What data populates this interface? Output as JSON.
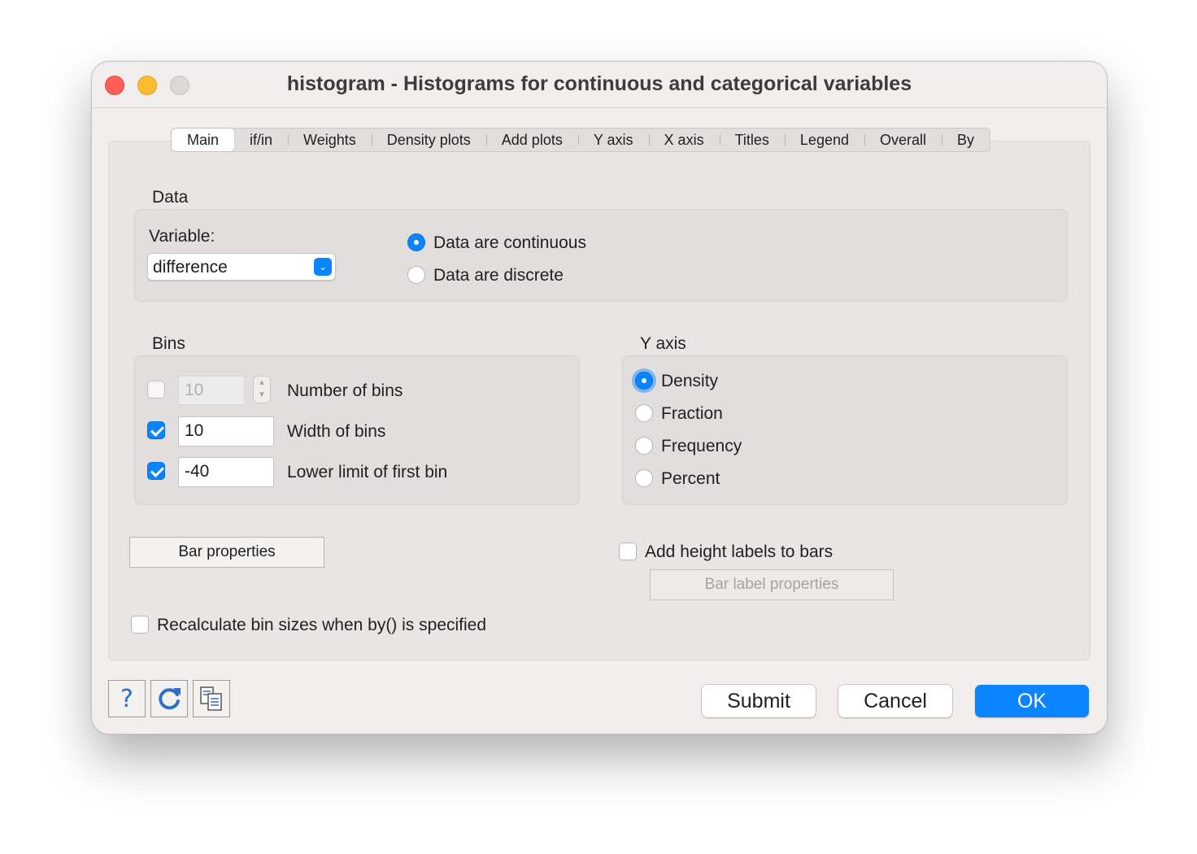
{
  "window": {
    "title": "histogram - Histograms for continuous and categorical variables"
  },
  "tabs": [
    "Main",
    "if/in",
    "Weights",
    "Density plots",
    "Add plots",
    "Y axis",
    "X axis",
    "Titles",
    "Legend",
    "Overall",
    "By"
  ],
  "data_section": {
    "heading": "Data",
    "variable_label": "Variable:",
    "variable_value": "difference",
    "continuous_label": "Data are continuous",
    "discrete_label": "Data are discrete",
    "selected": "continuous"
  },
  "bins": {
    "heading": "Bins",
    "number_of_bins": {
      "checked": false,
      "value": "10",
      "label": "Number of bins"
    },
    "width_of_bins": {
      "checked": true,
      "value": "10",
      "label": "Width of bins"
    },
    "lower_limit": {
      "checked": true,
      "value": "-40",
      "label": "Lower limit of first bin"
    }
  },
  "y_axis": {
    "heading": "Y axis",
    "options": [
      "Density",
      "Fraction",
      "Frequency",
      "Percent"
    ],
    "selected": "Density"
  },
  "bar_properties_label": "Bar properties",
  "height_labels": {
    "checked": false,
    "label": "Add height labels to bars"
  },
  "bar_label_properties_label": "Bar label properties",
  "recalculate": {
    "checked": false,
    "label": "Recalculate bin sizes when by() is specified"
  },
  "footer": {
    "help_icon": "question-mark-icon",
    "reset_icon": "refresh-icon",
    "copy_icon": "copy-command-icon",
    "submit_label": "Submit",
    "cancel_label": "Cancel",
    "ok_label": "OK"
  },
  "colors": {
    "accent": "#0a84ff",
    "close": "#ff5f57",
    "minimize": "#febc2e",
    "maximize": "#dcd8d8"
  }
}
